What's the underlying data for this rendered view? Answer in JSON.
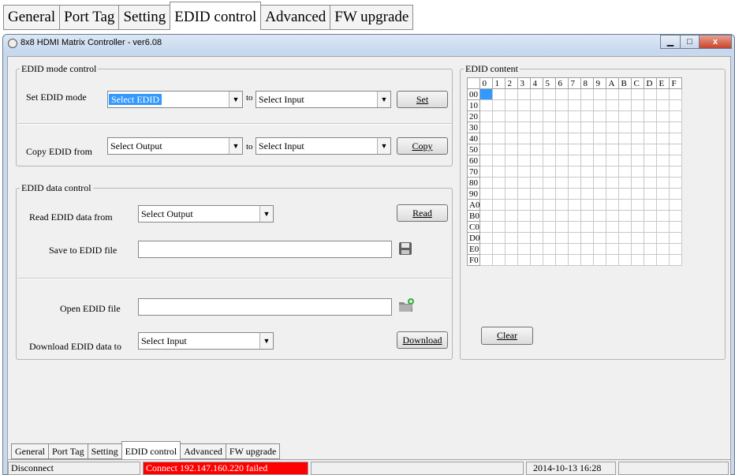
{
  "top_tabs": [
    "General",
    "Port Tag",
    "Setting",
    "EDID control",
    "Advanced",
    "FW upgrade"
  ],
  "top_active_tab": "EDID control",
  "window": {
    "title": "8x8 HDMI Matrix Controller - ver6.08",
    "minimize_glyph": "▁",
    "maximize_glyph": "□",
    "close_glyph": "x"
  },
  "edid_mode": {
    "group_label": "EDID mode control",
    "set_label": "Set EDID mode",
    "set_mode_value": "Select EDID",
    "to1": "to",
    "set_input_value": "Select Input",
    "set_button": "Set",
    "copy_label": "Copy EDID from",
    "copy_from_value": "Select Output",
    "to2": "to",
    "copy_input_value": "Select Input",
    "copy_button": "Copy"
  },
  "edid_data": {
    "group_label": "EDID data control",
    "read_label": "Read EDID data from",
    "read_value": "Select Output",
    "read_button": "Read",
    "save_label": "Save to EDID file",
    "save_path": "",
    "open_label": "Open EDID file",
    "open_path": "",
    "download_label": "Download EDID data to",
    "download_value": "Select Input",
    "download_button": "Download"
  },
  "edid_content": {
    "group_label": "EDID content",
    "col_headers": [
      "0",
      "1",
      "2",
      "3",
      "4",
      "5",
      "6",
      "7",
      "8",
      "9",
      "A",
      "B",
      "C",
      "D",
      "E",
      "F"
    ],
    "row_headers": [
      "00",
      "10",
      "20",
      "30",
      "40",
      "50",
      "60",
      "70",
      "80",
      "90",
      "A0",
      "B0",
      "C0",
      "D0",
      "E0",
      "F0"
    ],
    "clear_button": "Clear"
  },
  "bottom_tabs": [
    "General",
    "Port Tag",
    "Setting",
    "EDID control",
    "Advanced",
    "FW upgrade"
  ],
  "bottom_active_tab": "EDID control",
  "status": {
    "connection": "Disconnect",
    "message": "Connect 192.147.160.220 failed",
    "message_color": "#ff0000",
    "panel3": "",
    "datetime": "2014-10-13 16:28",
    "panel5": ""
  }
}
